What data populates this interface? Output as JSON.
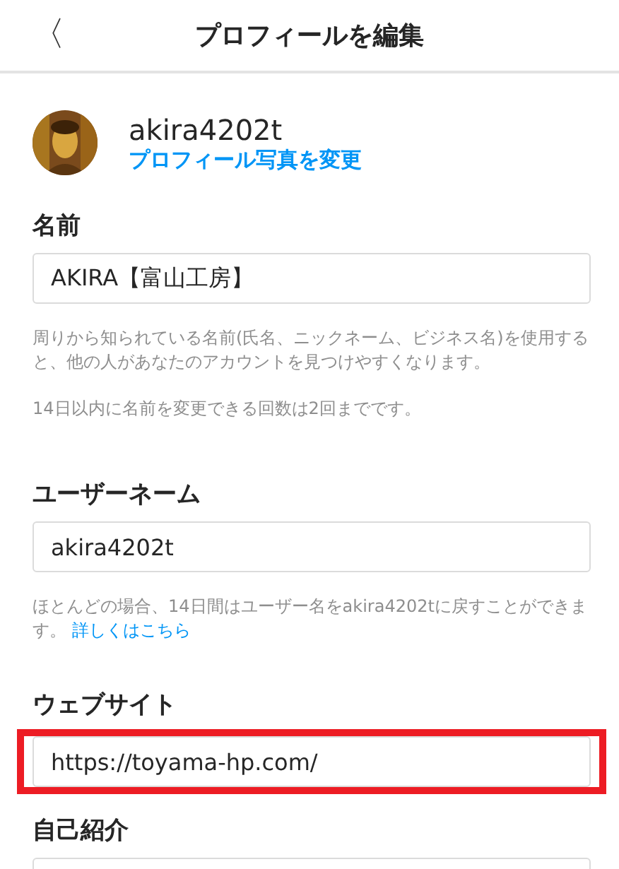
{
  "header": {
    "back": "〈",
    "title": "プロフィールを編集"
  },
  "profile": {
    "username": "akira4202t",
    "change_photo": "プロフィール写真を変更"
  },
  "fields": [
    {
      "kind": "input",
      "label": "名前",
      "value": "AKIRA【富山工房】",
      "highlighted": false,
      "notes": [
        "周りから知られている名前(氏名、ニックネーム、ビジネス名)を使用すると、他の人があなたのアカウントを見つけやすくなります。",
        "14日以内に名前を変更できる回数は2回までです。"
      ]
    },
    {
      "kind": "input",
      "label": "ユーザーネーム",
      "value": "akira4202t",
      "highlighted": false,
      "notes": [
        "ほとんどの場合、14日間はユーザー名をakira4202tに戻すことができます。"
      ],
      "link": "詳しくはこちら"
    },
    {
      "kind": "input",
      "label": "ウェブサイト",
      "value": "https://toyama-hp.com/",
      "highlighted": true
    },
    {
      "kind": "textarea",
      "label": "自己紹介",
      "highlighted": false
    }
  ]
}
